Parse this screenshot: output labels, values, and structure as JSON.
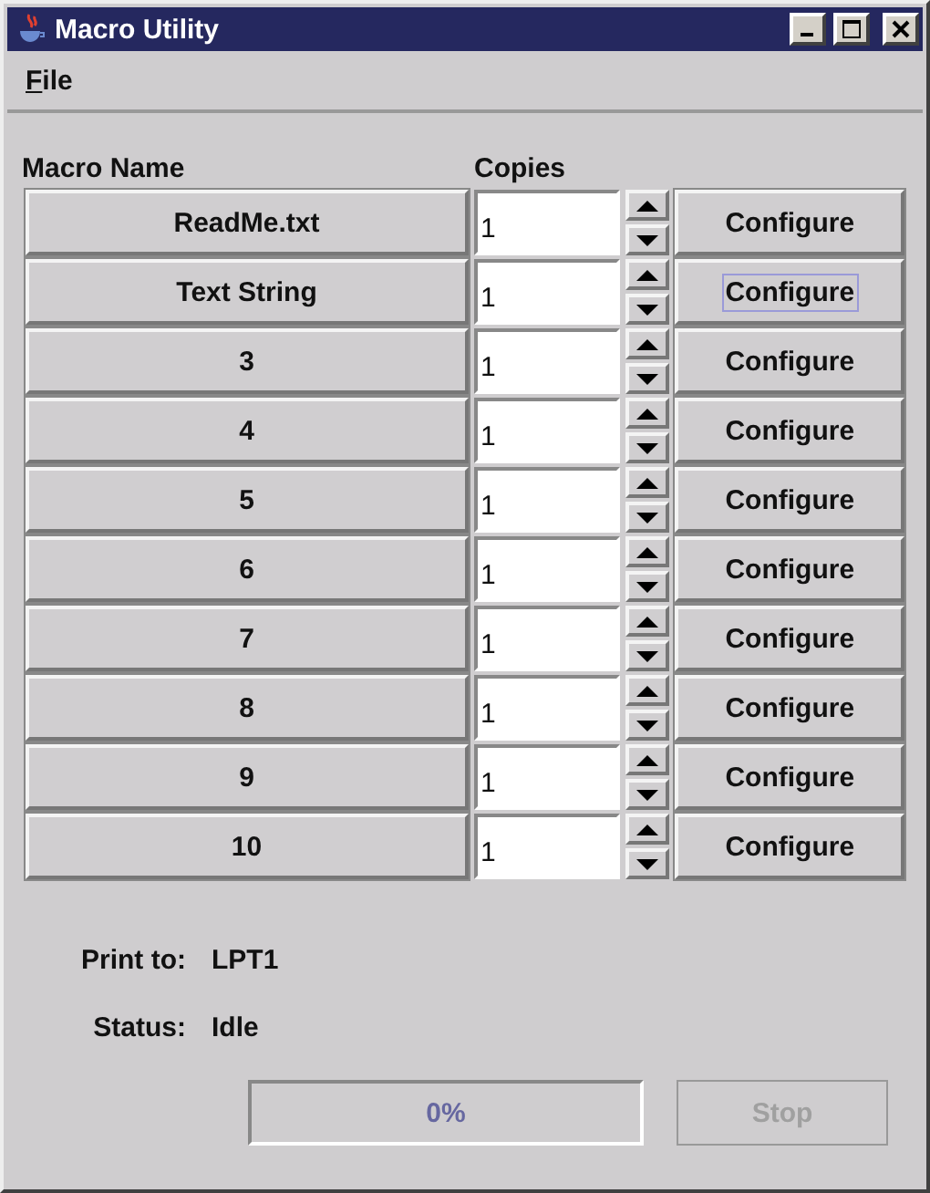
{
  "window": {
    "title": "Macro Utility"
  },
  "menu": [
    {
      "label": "File"
    }
  ],
  "columns": {
    "name": "Macro Name",
    "copies": "Copies"
  },
  "macros": [
    {
      "name": "ReadMe.txt",
      "copies": "1",
      "action": "Configure",
      "focused": false
    },
    {
      "name": "Text String",
      "copies": "1",
      "action": "Configure",
      "focused": true
    },
    {
      "name": "3",
      "copies": "1",
      "action": "Configure",
      "focused": false
    },
    {
      "name": "4",
      "copies": "1",
      "action": "Configure",
      "focused": false
    },
    {
      "name": "5",
      "copies": "1",
      "action": "Configure",
      "focused": false
    },
    {
      "name": "6",
      "copies": "1",
      "action": "Configure",
      "focused": false
    },
    {
      "name": "7",
      "copies": "1",
      "action": "Configure",
      "focused": false
    },
    {
      "name": "8",
      "copies": "1",
      "action": "Configure",
      "focused": false
    },
    {
      "name": "9",
      "copies": "1",
      "action": "Configure",
      "focused": false
    },
    {
      "name": "10",
      "copies": "1",
      "action": "Configure",
      "focused": false
    }
  ],
  "print_to": {
    "label": "Print to:",
    "value": "LPT1"
  },
  "status": {
    "label": "Status:",
    "value": "Idle"
  },
  "progress": {
    "level": 0,
    "text": "0%"
  },
  "stop_button": {
    "label": "Stop",
    "disabled": true
  }
}
